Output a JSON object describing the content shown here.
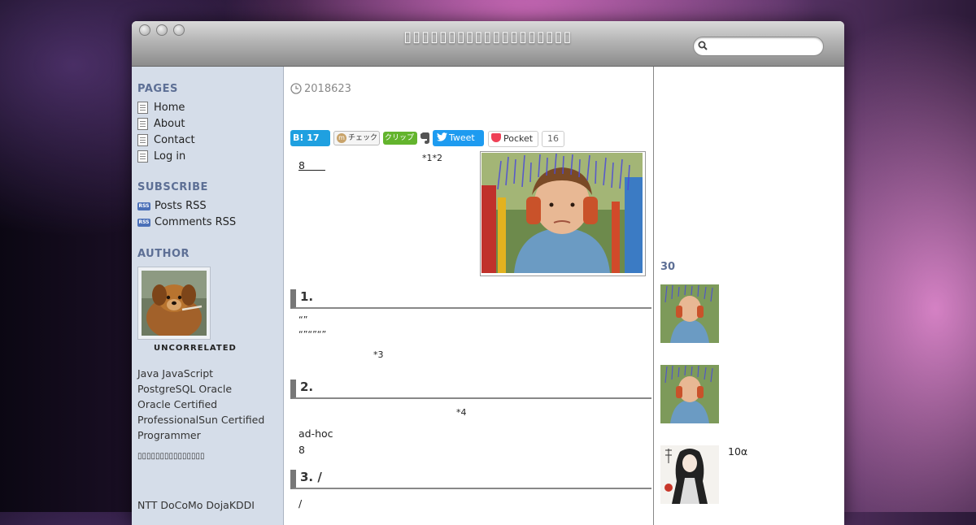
{
  "window": {
    "site_title": "▯▯▯▯▯▯▯▯▯▯▯▯▯▯▯▯▯▯▯"
  },
  "search": {
    "placeholder": ""
  },
  "sidebar": {
    "pages_heading": "PAGES",
    "pages": [
      "Home",
      "About",
      "Contact",
      "Log in"
    ],
    "subscribe_heading": "SUBSCRIBE",
    "subscribe_icon_label": "RSS",
    "subscribe": [
      "Posts RSS",
      "Comments RSS"
    ],
    "author_heading": "AUTHOR",
    "author_name": "UNCORRELATED",
    "bio": [
      "Java JavaScript",
      "PostgreSQL Oracle",
      "Oracle Certified",
      "ProfessionalSun Certified",
      "Programmer"
    ],
    "bio_extra": "▯▯▯▯▯▯▯▯▯▯▯▯▯▯▯",
    "bio_tail": "NTT DoCoMo DojaKDDI"
  },
  "post": {
    "date": "2018623",
    "share": {
      "hatena": "B!",
      "hatena_count": "17",
      "mixi": "チェック",
      "mixi_icon": "m",
      "clip": "クリップ",
      "tweet": "Tweet",
      "pocket": "Pocket",
      "pocket_count": "16"
    },
    "intro_link": "8　　",
    "intro_notes": "*1*2",
    "sections": [
      {
        "heading": "1.",
        "lines": [
          "“”",
          "“”“”“”"
        ],
        "note": "*3"
      },
      {
        "heading": "2.",
        "note": "*4",
        "lines": [
          "ad-hoc",
          "8"
        ]
      },
      {
        "heading": "3. /",
        "lines": [
          "/"
        ]
      }
    ]
  },
  "rightbar": {
    "heading": "30",
    "items": [
      {
        "label": ""
      },
      {
        "label": ""
      },
      {
        "label": "10α"
      }
    ]
  },
  "colors": {
    "sidebar_bg": "#d5dde9",
    "heading": "#5d6f95",
    "hatena": "#1fa0e0",
    "twitter": "#1d9bf0",
    "pocket": "#ef4056",
    "clip": "#63b42d"
  }
}
